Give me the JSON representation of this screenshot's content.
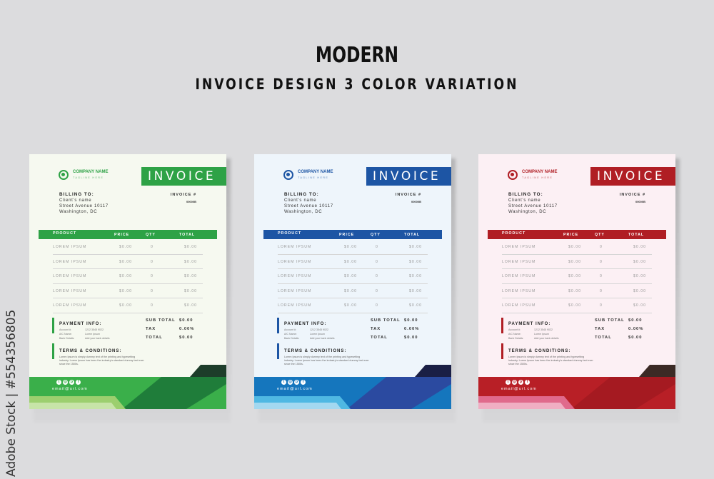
{
  "header": {
    "title": "MODERN",
    "subtitle": "INVOICE DESIGN 3 COLOR VARIATION"
  },
  "credit": "Adobe Stock | #554356805",
  "invoices": [
    {
      "variant": "green",
      "colors": {
        "accent": "#2ea246",
        "paper": "#f6f9f0",
        "footer_main": "#3aaf4a",
        "footer_dark": "#1f7d3a",
        "stripe_light": "#9ccf6f",
        "stripe_lighter": "#c7e4a8",
        "corner": "#1d3d2a"
      },
      "company_name": "COMPANY NAME",
      "tagline": "TAGLINE HERE",
      "invoice_title": "INVOICE",
      "billing": {
        "label": "BILLING TO:",
        "client": "Client's name",
        "street": "Street Avenue 10117",
        "city": "Washington, DC"
      },
      "invoice_number": {
        "label": "INVOICE #",
        "value": "00000B"
      },
      "table": {
        "columns": [
          "PRODUCT",
          "PRICE",
          "QTY",
          "TOTAL"
        ],
        "rows": [
          [
            "LOREM IPSUM",
            "$0.00",
            "0",
            "$0.00"
          ],
          [
            "LOREM IPSUM",
            "$0.00",
            "0",
            "$0.00"
          ],
          [
            "LOREM IPSUM",
            "$0.00",
            "0",
            "$0.00"
          ],
          [
            "LOREM IPSUM",
            "$0.00",
            "0",
            "$0.00"
          ],
          [
            "LOREM IPSUM",
            "$0.00",
            "0",
            "$0.00"
          ]
        ]
      },
      "payment": {
        "title": "PAYMENT INFO:",
        "items": [
          {
            "key": "Account #:",
            "value": "1212 3545 9022"
          },
          {
            "key": "A/C Name:",
            "value": "Lorem Ipsum"
          },
          {
            "key": "Bank Details:",
            "value": "Add your bank details"
          }
        ]
      },
      "totals": [
        {
          "label": "SUB TOTAL",
          "value": "$0.00"
        },
        {
          "label": "TAX",
          "value": "0.00%"
        },
        {
          "label": "TOTAL",
          "value": "$0.00"
        }
      ],
      "terms": {
        "title": "TERMS & CONDITIONS:",
        "text": "Lorem Ipsum is simply dummy text of the printing and typesetting industry. Lorem Ipsum has been the industry's standard dummy text ever since the 1500s."
      },
      "socials": [
        "twitter-icon",
        "instagram-icon",
        "pinterest-icon",
        "facebook-icon"
      ],
      "email": "email@url.com"
    },
    {
      "variant": "blue",
      "colors": {
        "accent": "#1d55a4",
        "paper": "#eef5fb",
        "footer_main": "#1576bd",
        "footer_dark": "#2b4aa0",
        "stripe_light": "#4fb8e3",
        "stripe_lighter": "#a3d8f0",
        "corner": "#1a1f45"
      },
      "company_name": "COMPANY NAME",
      "tagline": "TAGLINE HERE",
      "invoice_title": "INVOICE",
      "billing": {
        "label": "BILLING TO:",
        "client": "Client's name",
        "street": "Street Avenue 10117",
        "city": "Washington, DC"
      },
      "invoice_number": {
        "label": "INVOICE #",
        "value": "00000B"
      },
      "table": {
        "columns": [
          "PRODUCT",
          "PRICE",
          "QTY",
          "TOTAL"
        ],
        "rows": [
          [
            "LOREM IPSUM",
            "$0.00",
            "0",
            "$0.00"
          ],
          [
            "LOREM IPSUM",
            "$0.00",
            "0",
            "$0.00"
          ],
          [
            "LOREM IPSUM",
            "$0.00",
            "0",
            "$0.00"
          ],
          [
            "LOREM IPSUM",
            "$0.00",
            "0",
            "$0.00"
          ],
          [
            "LOREM IPSUM",
            "$0.00",
            "0",
            "$0.00"
          ]
        ]
      },
      "payment": {
        "title": "PAYMENT INFO:",
        "items": [
          {
            "key": "Account #:",
            "value": "1212 3545 9022"
          },
          {
            "key": "A/C Name:",
            "value": "Lorem Ipsum"
          },
          {
            "key": "Bank Details:",
            "value": "Add your bank details"
          }
        ]
      },
      "totals": [
        {
          "label": "SUB TOTAL",
          "value": "$0.00"
        },
        {
          "label": "TAX",
          "value": "0.00%"
        },
        {
          "label": "TOTAL",
          "value": "$0.00"
        }
      ],
      "terms": {
        "title": "TERMS & CONDITIONS:",
        "text": "Lorem Ipsum is simply dummy text of the printing and typesetting industry. Lorem Ipsum has been the industry's standard dummy text ever since the 1500s."
      },
      "socials": [
        "twitter-icon",
        "instagram-icon",
        "pinterest-icon",
        "facebook-icon"
      ],
      "email": "email@url.com"
    },
    {
      "variant": "red",
      "colors": {
        "accent": "#b01e24",
        "paper": "#fcf0f4",
        "footer_main": "#b81f26",
        "footer_dark": "#a51a21",
        "stripe_light": "#e06a8c",
        "stripe_lighter": "#f0aec3",
        "corner": "#3b2a25"
      },
      "company_name": "COMPANY NAME",
      "tagline": "TAGLINE HERE",
      "invoice_title": "INVOICE",
      "billing": {
        "label": "BILLING TO:",
        "client": "Client's name",
        "street": "Street Avenue 10117",
        "city": "Washington, DC"
      },
      "invoice_number": {
        "label": "INVOICE #",
        "value": "00000B"
      },
      "table": {
        "columns": [
          "PRODUCT",
          "PRICE",
          "QTY",
          "TOTAL"
        ],
        "rows": [
          [
            "LOREM IPSUM",
            "$0.00",
            "0",
            "$0.00"
          ],
          [
            "LOREM IPSUM",
            "$0.00",
            "0",
            "$0.00"
          ],
          [
            "LOREM IPSUM",
            "$0.00",
            "0",
            "$0.00"
          ],
          [
            "LOREM IPSUM",
            "$0.00",
            "0",
            "$0.00"
          ],
          [
            "LOREM IPSUM",
            "$0.00",
            "0",
            "$0.00"
          ]
        ]
      },
      "payment": {
        "title": "PAYMENT INFO:",
        "items": [
          {
            "key": "Account #:",
            "value": "1212 3545 9022"
          },
          {
            "key": "A/C Name:",
            "value": "Lorem Ipsum"
          },
          {
            "key": "Bank Details:",
            "value": "Add your bank details"
          }
        ]
      },
      "totals": [
        {
          "label": "SUB TOTAL",
          "value": "$0.00"
        },
        {
          "label": "TAX",
          "value": "0.00%"
        },
        {
          "label": "TOTAL",
          "value": "$0.00"
        }
      ],
      "terms": {
        "title": "TERMS & CONDITIONS:",
        "text": "Lorem Ipsum is simply dummy text of the printing and typesetting industry. Lorem Ipsum has been the industry's standard dummy text ever since the 1500s."
      },
      "socials": [
        "twitter-icon",
        "instagram-icon",
        "pinterest-icon",
        "facebook-icon"
      ],
      "email": "email@url.com"
    }
  ]
}
